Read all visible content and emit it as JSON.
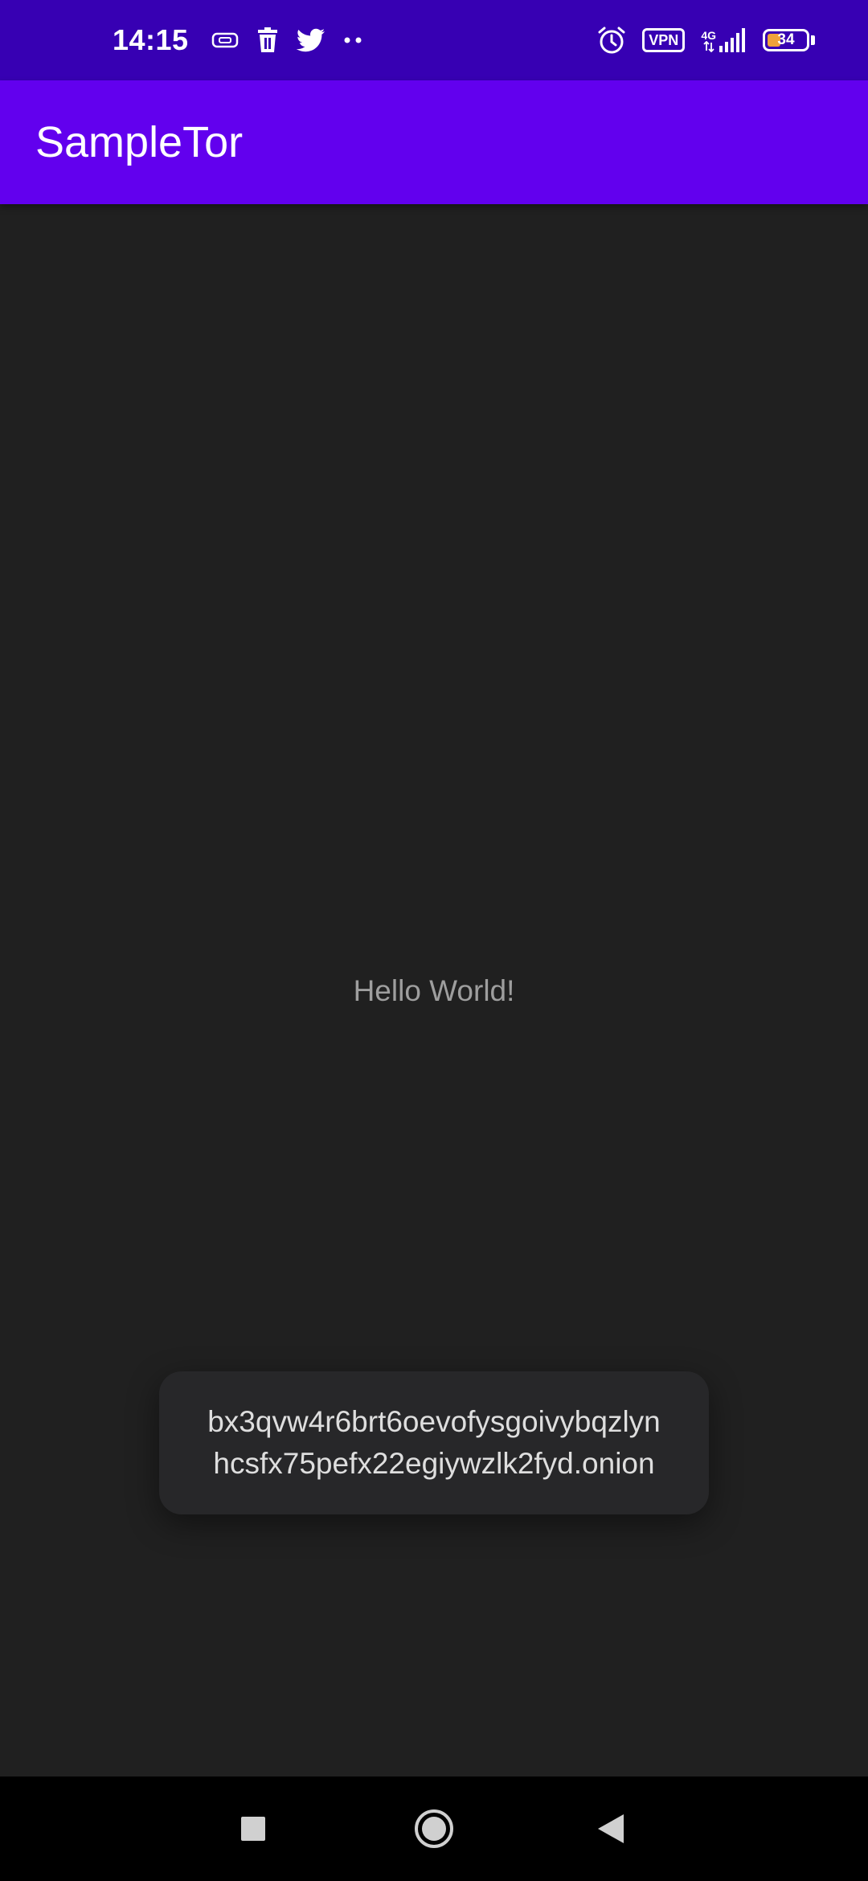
{
  "status_bar": {
    "time": "14:15",
    "network_type": "4G",
    "vpn_label": "VPN",
    "battery_level": "34",
    "battery_fraction": 0.34,
    "icons_left": [
      "card-icon",
      "trash-icon",
      "twitter-icon",
      "more-dots-icon"
    ],
    "icons_right": [
      "alarm-icon",
      "vpn-icon",
      "signal-icon",
      "battery-icon"
    ],
    "color": "#3700b3"
  },
  "app_bar": {
    "title": "SampleTor",
    "color": "#6200ee"
  },
  "main": {
    "text": "Hello World!",
    "background": "#202020"
  },
  "toast": {
    "line1": "bx3qvw4r6brt6oevofysgoivybqzlyn",
    "line2": "hcsfx75pefx22egiywzlk2fyd.onion"
  },
  "nav_bar": {
    "buttons": [
      "recents-square-icon",
      "home-circle-icon",
      "back-triangle-icon"
    ]
  }
}
